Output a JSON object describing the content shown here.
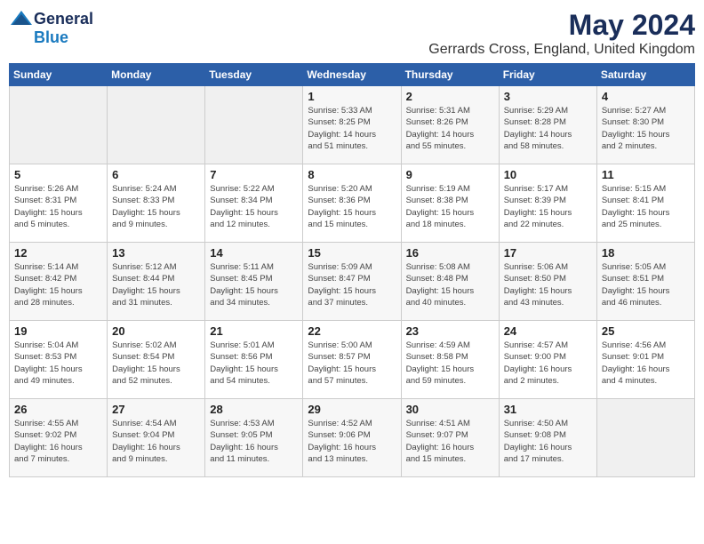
{
  "logo": {
    "general": "General",
    "blue": "Blue"
  },
  "header": {
    "month": "May 2024",
    "location": "Gerrards Cross, England, United Kingdom"
  },
  "weekdays": [
    "Sunday",
    "Monday",
    "Tuesday",
    "Wednesday",
    "Thursday",
    "Friday",
    "Saturday"
  ],
  "weeks": [
    [
      {
        "day": "",
        "info": ""
      },
      {
        "day": "",
        "info": ""
      },
      {
        "day": "",
        "info": ""
      },
      {
        "day": "1",
        "info": "Sunrise: 5:33 AM\nSunset: 8:25 PM\nDaylight: 14 hours\nand 51 minutes."
      },
      {
        "day": "2",
        "info": "Sunrise: 5:31 AM\nSunset: 8:26 PM\nDaylight: 14 hours\nand 55 minutes."
      },
      {
        "day": "3",
        "info": "Sunrise: 5:29 AM\nSunset: 8:28 PM\nDaylight: 14 hours\nand 58 minutes."
      },
      {
        "day": "4",
        "info": "Sunrise: 5:27 AM\nSunset: 8:30 PM\nDaylight: 15 hours\nand 2 minutes."
      }
    ],
    [
      {
        "day": "5",
        "info": "Sunrise: 5:26 AM\nSunset: 8:31 PM\nDaylight: 15 hours\nand 5 minutes."
      },
      {
        "day": "6",
        "info": "Sunrise: 5:24 AM\nSunset: 8:33 PM\nDaylight: 15 hours\nand 9 minutes."
      },
      {
        "day": "7",
        "info": "Sunrise: 5:22 AM\nSunset: 8:34 PM\nDaylight: 15 hours\nand 12 minutes."
      },
      {
        "day": "8",
        "info": "Sunrise: 5:20 AM\nSunset: 8:36 PM\nDaylight: 15 hours\nand 15 minutes."
      },
      {
        "day": "9",
        "info": "Sunrise: 5:19 AM\nSunset: 8:38 PM\nDaylight: 15 hours\nand 18 minutes."
      },
      {
        "day": "10",
        "info": "Sunrise: 5:17 AM\nSunset: 8:39 PM\nDaylight: 15 hours\nand 22 minutes."
      },
      {
        "day": "11",
        "info": "Sunrise: 5:15 AM\nSunset: 8:41 PM\nDaylight: 15 hours\nand 25 minutes."
      }
    ],
    [
      {
        "day": "12",
        "info": "Sunrise: 5:14 AM\nSunset: 8:42 PM\nDaylight: 15 hours\nand 28 minutes."
      },
      {
        "day": "13",
        "info": "Sunrise: 5:12 AM\nSunset: 8:44 PM\nDaylight: 15 hours\nand 31 minutes."
      },
      {
        "day": "14",
        "info": "Sunrise: 5:11 AM\nSunset: 8:45 PM\nDaylight: 15 hours\nand 34 minutes."
      },
      {
        "day": "15",
        "info": "Sunrise: 5:09 AM\nSunset: 8:47 PM\nDaylight: 15 hours\nand 37 minutes."
      },
      {
        "day": "16",
        "info": "Sunrise: 5:08 AM\nSunset: 8:48 PM\nDaylight: 15 hours\nand 40 minutes."
      },
      {
        "day": "17",
        "info": "Sunrise: 5:06 AM\nSunset: 8:50 PM\nDaylight: 15 hours\nand 43 minutes."
      },
      {
        "day": "18",
        "info": "Sunrise: 5:05 AM\nSunset: 8:51 PM\nDaylight: 15 hours\nand 46 minutes."
      }
    ],
    [
      {
        "day": "19",
        "info": "Sunrise: 5:04 AM\nSunset: 8:53 PM\nDaylight: 15 hours\nand 49 minutes."
      },
      {
        "day": "20",
        "info": "Sunrise: 5:02 AM\nSunset: 8:54 PM\nDaylight: 15 hours\nand 52 minutes."
      },
      {
        "day": "21",
        "info": "Sunrise: 5:01 AM\nSunset: 8:56 PM\nDaylight: 15 hours\nand 54 minutes."
      },
      {
        "day": "22",
        "info": "Sunrise: 5:00 AM\nSunset: 8:57 PM\nDaylight: 15 hours\nand 57 minutes."
      },
      {
        "day": "23",
        "info": "Sunrise: 4:59 AM\nSunset: 8:58 PM\nDaylight: 15 hours\nand 59 minutes."
      },
      {
        "day": "24",
        "info": "Sunrise: 4:57 AM\nSunset: 9:00 PM\nDaylight: 16 hours\nand 2 minutes."
      },
      {
        "day": "25",
        "info": "Sunrise: 4:56 AM\nSunset: 9:01 PM\nDaylight: 16 hours\nand 4 minutes."
      }
    ],
    [
      {
        "day": "26",
        "info": "Sunrise: 4:55 AM\nSunset: 9:02 PM\nDaylight: 16 hours\nand 7 minutes."
      },
      {
        "day": "27",
        "info": "Sunrise: 4:54 AM\nSunset: 9:04 PM\nDaylight: 16 hours\nand 9 minutes."
      },
      {
        "day": "28",
        "info": "Sunrise: 4:53 AM\nSunset: 9:05 PM\nDaylight: 16 hours\nand 11 minutes."
      },
      {
        "day": "29",
        "info": "Sunrise: 4:52 AM\nSunset: 9:06 PM\nDaylight: 16 hours\nand 13 minutes."
      },
      {
        "day": "30",
        "info": "Sunrise: 4:51 AM\nSunset: 9:07 PM\nDaylight: 16 hours\nand 15 minutes."
      },
      {
        "day": "31",
        "info": "Sunrise: 4:50 AM\nSunset: 9:08 PM\nDaylight: 16 hours\nand 17 minutes."
      },
      {
        "day": "",
        "info": ""
      }
    ]
  ]
}
